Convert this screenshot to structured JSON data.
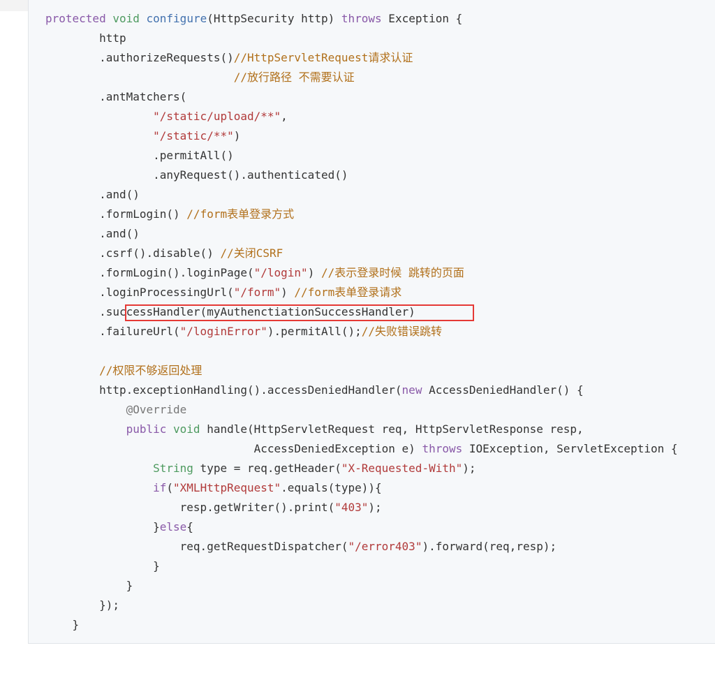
{
  "colors": {
    "keyword": "#8959a8",
    "type_keyword": "#4d9a5f",
    "string": "#b13a3a",
    "comment": "#b1701b",
    "function": "#4271ae",
    "plain": "#333333",
    "annotation": "#777777",
    "highlight_border": "#e53935",
    "code_background": "#f6f8fa"
  },
  "highlight": {
    "line_index": 15,
    "text": ".successHandler(myAuthenctiationSuccessHandler)"
  },
  "code_lines": [
    [
      [
        "t-kw",
        "protected"
      ],
      [
        "t-pl",
        " "
      ],
      [
        "t-kw2",
        "void"
      ],
      [
        "t-pl",
        " "
      ],
      [
        "t-fn",
        "configure"
      ],
      [
        "t-pl",
        "(HttpSecurity http) "
      ],
      [
        "t-kw",
        "throws"
      ],
      [
        "t-pl",
        " Exception {"
      ]
    ],
    [
      [
        "t-pl",
        "        http"
      ]
    ],
    [
      [
        "t-pl",
        "        .authorizeRequests()"
      ],
      [
        "t-cm",
        "//HttpServletRequest请求认证"
      ]
    ],
    [
      [
        "t-pl",
        "                            "
      ],
      [
        "t-cm",
        "//放行路径 不需要认证"
      ]
    ],
    [
      [
        "t-pl",
        "        .antMatchers("
      ]
    ],
    [
      [
        "t-pl",
        "                "
      ],
      [
        "t-str",
        "\"/static/upload/**\""
      ],
      [
        "t-pl",
        ","
      ]
    ],
    [
      [
        "t-pl",
        "                "
      ],
      [
        "t-str",
        "\"/static/**\""
      ],
      [
        "t-pl",
        ")"
      ]
    ],
    [
      [
        "t-pl",
        "                .permitAll()"
      ]
    ],
    [
      [
        "t-pl",
        "                .anyRequest().authenticated()"
      ]
    ],
    [
      [
        "t-pl",
        "        .and()"
      ]
    ],
    [
      [
        "t-pl",
        "        .formLogin() "
      ],
      [
        "t-cm",
        "//form表单登录方式"
      ]
    ],
    [
      [
        "t-pl",
        "        .and()"
      ]
    ],
    [
      [
        "t-pl",
        "        .csrf().disable() "
      ],
      [
        "t-cm",
        "//关闭CSRF"
      ]
    ],
    [
      [
        "t-pl",
        "        .formLogin().loginPage("
      ],
      [
        "t-str",
        "\"/login\""
      ],
      [
        "t-pl",
        ") "
      ],
      [
        "t-cm",
        "//表示登录时候 跳转的页面"
      ]
    ],
    [
      [
        "t-pl",
        "        .loginProcessingUrl("
      ],
      [
        "t-str",
        "\"/form\""
      ],
      [
        "t-pl",
        ") "
      ],
      [
        "t-cm",
        "//form表单登录请求"
      ]
    ],
    [
      [
        "t-pl",
        "        .successHandler(myAuthenctiationSuccessHandler)"
      ]
    ],
    [
      [
        "t-pl",
        "        .failureUrl("
      ],
      [
        "t-str",
        "\"/loginError\""
      ],
      [
        "t-pl",
        ").permitAll();"
      ],
      [
        "t-cm",
        "//失败错误跳转"
      ]
    ],
    [
      [
        "t-pl",
        ""
      ]
    ],
    [
      [
        "t-pl",
        "        "
      ],
      [
        "t-cm",
        "//权限不够返回处理"
      ]
    ],
    [
      [
        "t-pl",
        "        http.exceptionHandling().accessDeniedHandler("
      ],
      [
        "t-kw",
        "new"
      ],
      [
        "t-pl",
        " AccessDeniedHandler() {"
      ]
    ],
    [
      [
        "t-pl",
        "            "
      ],
      [
        "t-ann",
        "@Override"
      ]
    ],
    [
      [
        "t-pl",
        "            "
      ],
      [
        "t-kw",
        "public"
      ],
      [
        "t-pl",
        " "
      ],
      [
        "t-kw2",
        "void"
      ],
      [
        "t-pl",
        " handle(HttpServletRequest req, HttpServletResponse resp,"
      ]
    ],
    [
      [
        "t-pl",
        "                               AccessDeniedException e) "
      ],
      [
        "t-kw",
        "throws"
      ],
      [
        "t-pl",
        " IOException, ServletException {"
      ]
    ],
    [
      [
        "t-pl",
        "                "
      ],
      [
        "t-kw2",
        "String"
      ],
      [
        "t-pl",
        " type = req.getHeader("
      ],
      [
        "t-str",
        "\"X-Requested-With\""
      ],
      [
        "t-pl",
        ");"
      ]
    ],
    [
      [
        "t-pl",
        "                "
      ],
      [
        "t-kw",
        "if"
      ],
      [
        "t-pl",
        "("
      ],
      [
        "t-str",
        "\"XMLHttpRequest\""
      ],
      [
        "t-pl",
        ".equals(type)){"
      ]
    ],
    [
      [
        "t-pl",
        "                    resp.getWriter().print("
      ],
      [
        "t-str",
        "\"403\""
      ],
      [
        "t-pl",
        ");"
      ]
    ],
    [
      [
        "t-pl",
        "                }"
      ],
      [
        "t-kw",
        "else"
      ],
      [
        "t-pl",
        "{"
      ]
    ],
    [
      [
        "t-pl",
        "                    req.getRequestDispatcher("
      ],
      [
        "t-str",
        "\"/error403\""
      ],
      [
        "t-pl",
        ").forward(req,resp);"
      ]
    ],
    [
      [
        "t-pl",
        "                }"
      ]
    ],
    [
      [
        "t-pl",
        "            }"
      ]
    ],
    [
      [
        "t-pl",
        "        });"
      ]
    ],
    [
      [
        "t-pl",
        "    }"
      ]
    ]
  ]
}
